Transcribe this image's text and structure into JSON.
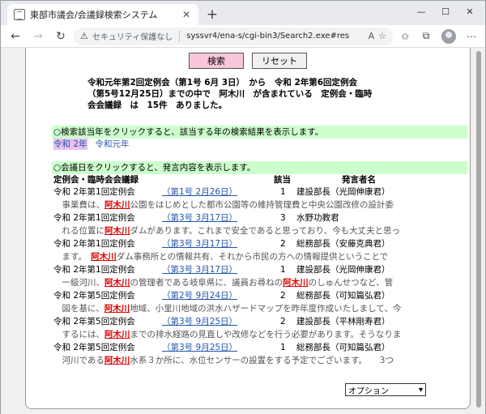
{
  "browser": {
    "tab_title": "東部市議会/会議録検索システム",
    "tab_close": "✕",
    "new_tab": "+",
    "security_label": "セキュリティ保護なし",
    "url": "syssvr4/ena-s/cgi-bin3/Search2.exe#res"
  },
  "buttons": {
    "search": "検索",
    "reset": "リセット"
  },
  "summary": {
    "line1": "令和元年第2回定例会（第1号 6月 3日）　から　令和 2年第6回定例会",
    "line2": "（第5号12月25日）までの中で　阿木川　が含まれている　定例会・臨時",
    "line3": "会会議録　は　15件　ありました。"
  },
  "year_section": {
    "notice": "○検索該当年をクリックすると、該当する年の検索結果を表示します。",
    "years": [
      "令和 2年",
      "令和元年"
    ]
  },
  "meeting_section": {
    "notice": "○会議日をクリックすると、発言内容を表示します。",
    "columns": {
      "meeting": "定例会・臨時会会議録",
      "hits": "該当",
      "speaker": "発言者名"
    },
    "keyword": "阿木川",
    "rows": [
      {
        "meeting": "令和 2年第1回定例会",
        "date": "（第1号 2月26日）",
        "hits": "1",
        "speaker": "建設部長（光岡伸康君）",
        "pre": "　事業費は、",
        "post": "公園をはじめとした都市公園等の維持管理費と中央公園改修の設計委",
        "extra": "",
        "post2": ""
      },
      {
        "meeting": "令和 2年第1回定例会",
        "date": "（第3号 3月17日）",
        "hits": "3",
        "speaker": "水野功教君",
        "pre": "　れる位置に",
        "post": "ダムがあります。これまで安全であると思っており、今も大丈夫と思っ",
        "extra": "",
        "post2": ""
      },
      {
        "meeting": "令和 2年第1回定例会",
        "date": "（第3号 3月17日）",
        "hits": "2",
        "speaker": "総務部長（安藤克典君）",
        "pre": "　ます。　",
        "post": "ダム事務所との情報共有、それから市民の方への情報提供ということで",
        "extra": "",
        "post2": ""
      },
      {
        "meeting": "令和 2年第1回定例会",
        "date": "（第3号 3月17日）",
        "hits": "1",
        "speaker": "建設部長（光岡伸康君）",
        "pre": "　一級河川、",
        "post": "の管理者である岐阜県に、議員お尋ねの",
        "extra": "阿木川",
        "post2": "のしゅんせつなど、管"
      },
      {
        "meeting": "令和 2年第5回定例会",
        "date": "（第2号 9月24日）",
        "hits": "2",
        "speaker": "総務部長（可知篇弘君）",
        "pre": "　図を基に、",
        "post": "地域、小里川地域の洪水ハザードマップを昨年度作成いたしまして、今",
        "extra": "",
        "post2": ""
      },
      {
        "meeting": "令和 2年第5回定例会",
        "date": "（第3号 9月25日）",
        "hits": "2",
        "speaker": "建設部長（平林剛寿君）",
        "pre": "　するには、",
        "post": "までの排水経路の見直しや改修などを行う必要があります。そうなりま",
        "extra": "",
        "post2": ""
      },
      {
        "meeting": "令和 2年第5回定例会",
        "date": "（第3号 9月25日）",
        "hits": "1",
        "speaker": "総務部長（可知篇弘君）",
        "pre": "　河川である",
        "post": "水系３か所に、水位センサーの設置をする予定でございます。　　3つ",
        "extra": "",
        "post2": ""
      }
    ]
  },
  "options": {
    "selected": "オプション"
  }
}
